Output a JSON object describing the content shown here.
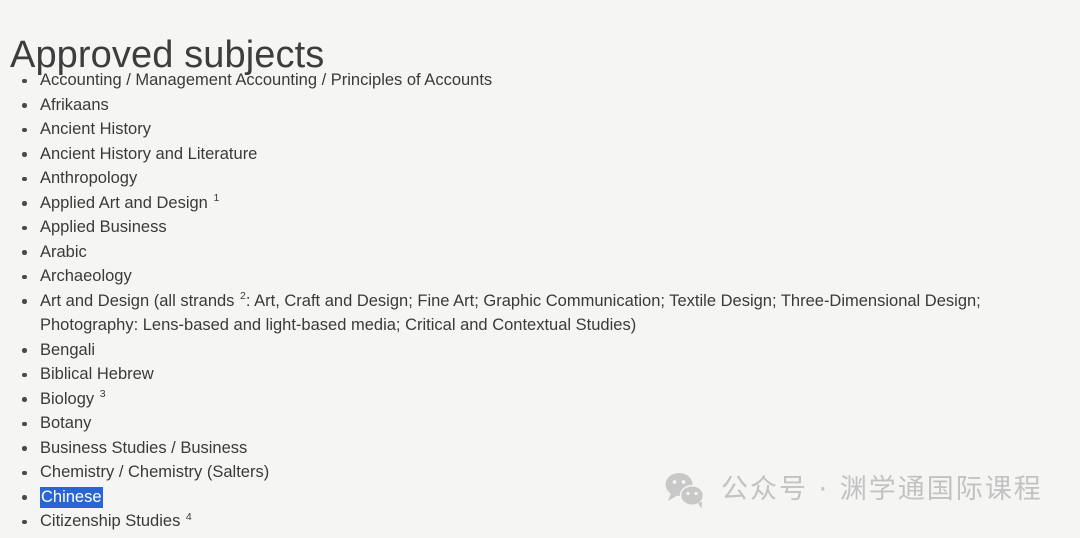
{
  "page": {
    "title": "Approved subjects",
    "background_color": "#f5f5f4",
    "text_color": "#3a3a3a",
    "selection_color": "#2a65d6"
  },
  "subjects": [
    {
      "text": "Accounting / Management Accounting / Principles of Accounts",
      "note": "",
      "selected": false
    },
    {
      "text": "Afrikaans",
      "note": "",
      "selected": false
    },
    {
      "text": "Ancient History",
      "note": "",
      "selected": false
    },
    {
      "text": "Ancient History and Literature",
      "note": "",
      "selected": false
    },
    {
      "text": "Anthropology",
      "note": "",
      "selected": false
    },
    {
      "text": "Applied Art and Design",
      "note": "1",
      "selected": false
    },
    {
      "text": "Applied Business",
      "note": "",
      "selected": false
    },
    {
      "text": "Arabic",
      "note": "",
      "selected": false
    },
    {
      "text": "Archaeology",
      "note": "",
      "selected": false
    },
    {
      "text": "Art and Design (all strands",
      "note": "2",
      "text_after": ": Art, Craft and Design; Fine Art; Graphic Communication; Textile Design; Three-Dimensional Design; Photography: Lens-based and light-based media; Critical and Contextual Studies)",
      "selected": false
    },
    {
      "text": "Bengali",
      "note": "",
      "selected": false
    },
    {
      "text": "Biblical Hebrew",
      "note": "",
      "selected": false
    },
    {
      "text": "Biology",
      "note": "3",
      "selected": false
    },
    {
      "text": "Botany",
      "note": "",
      "selected": false
    },
    {
      "text": "Business Studies / Business",
      "note": "",
      "selected": false
    },
    {
      "text": "Chemistry / Chemistry (Salters)",
      "note": "",
      "selected": false
    },
    {
      "text": "Chinese",
      "note": "",
      "selected": true
    },
    {
      "text": "Citizenship Studies",
      "note": "4",
      "selected": false
    }
  ],
  "watermark": {
    "logo": "wechat-logo-icon",
    "text": "公众号 · 渊学通国际课程",
    "color": "#c2c2c2"
  }
}
